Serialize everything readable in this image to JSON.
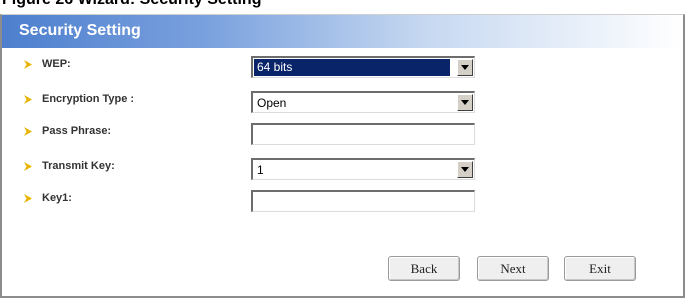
{
  "caption": {
    "text": "Figure 26 Wizard: Security Setting"
  },
  "panel": {
    "title": "Security Setting",
    "accent_colors": [
      "#4d7fce",
      "#ffffff"
    ],
    "arrow_color": "#e8b400"
  },
  "form": {
    "wep": {
      "label": "WEP:",
      "value": "64 bits",
      "icon": "chevron-down-icon"
    },
    "encryption_type": {
      "label": "Encryption Type :",
      "value": "Open",
      "icon": "chevron-down-icon"
    },
    "pass_phrase": {
      "label": "Pass Phrase:",
      "value": ""
    },
    "transmit_key": {
      "label": "Transmit Key:",
      "value": "1",
      "icon": "chevron-down-icon"
    },
    "key1": {
      "label": "Key1:",
      "value": ""
    }
  },
  "buttons": {
    "back": "Back",
    "next": "Next",
    "exit": "Exit"
  }
}
